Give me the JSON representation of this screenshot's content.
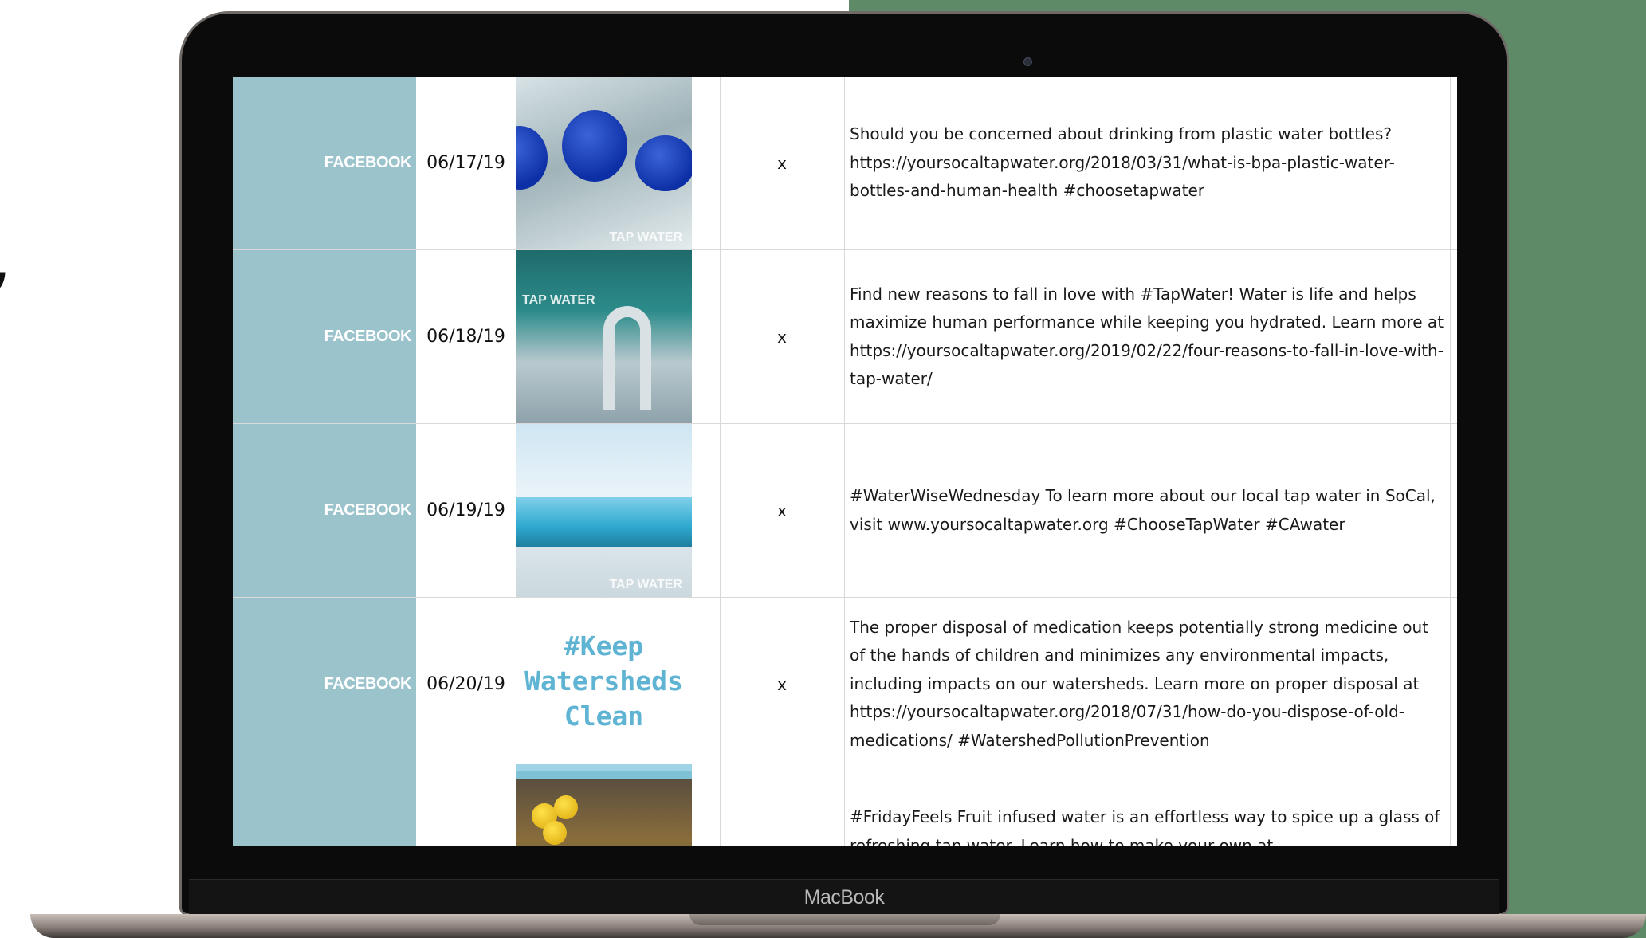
{
  "device": {
    "brand": "MacBook"
  },
  "rows": [
    {
      "platform": "FACEBOOK",
      "date": "06/17/19",
      "mark": "x",
      "image_text": "TAP WATER",
      "text": "Should you be concerned about drinking from plastic water bottles? https://yoursocaltapwater.org/2018/03/31/what-is-bpa-plastic-water-bottles-and-human-health #choosetapwater"
    },
    {
      "platform": "FACEBOOK",
      "date": "06/18/19",
      "mark": "x",
      "image_text": "TAP WATER",
      "text": "Find new reasons to fall in love with #TapWater! Water is life and helps maximize human performance while keeping you hydrated. Learn more at https://yoursocaltapwater.org/2019/02/22/four-reasons-to-fall-in-love-with-tap-water/"
    },
    {
      "platform": "FACEBOOK",
      "date": "06/19/19",
      "mark": "x",
      "image_text": "TAP WATER",
      "text": "#WaterWiseWednesday To learn more about our local tap water in SoCal, visit www.yoursocaltapwater.org #ChooseTapWater #CAwater"
    },
    {
      "platform": "FACEBOOK",
      "date": "06/20/19",
      "mark": "x",
      "image_text": "#Keep Watersheds Clean",
      "text": "The proper disposal of medication keeps potentially strong medicine out of the hands of children and minimizes any environmental impacts, including impacts on our watersheds. Learn more on proper disposal at https://yoursocaltapwater.org/2018/07/31/how-do-you-dispose-of-old-medications/ #WatershedPollutionPrevention"
    },
    {
      "platform": "",
      "date": "",
      "mark": "",
      "text": "#FridayFeels Fruit infused water is an effortless way to spice up a glass of refreshing tap water. Learn how to make your own at"
    }
  ],
  "colors": {
    "platform_column": "#9ac3cc",
    "background_panel": "#5e8a68",
    "thumbnail_text": "#5fb3d3"
  }
}
